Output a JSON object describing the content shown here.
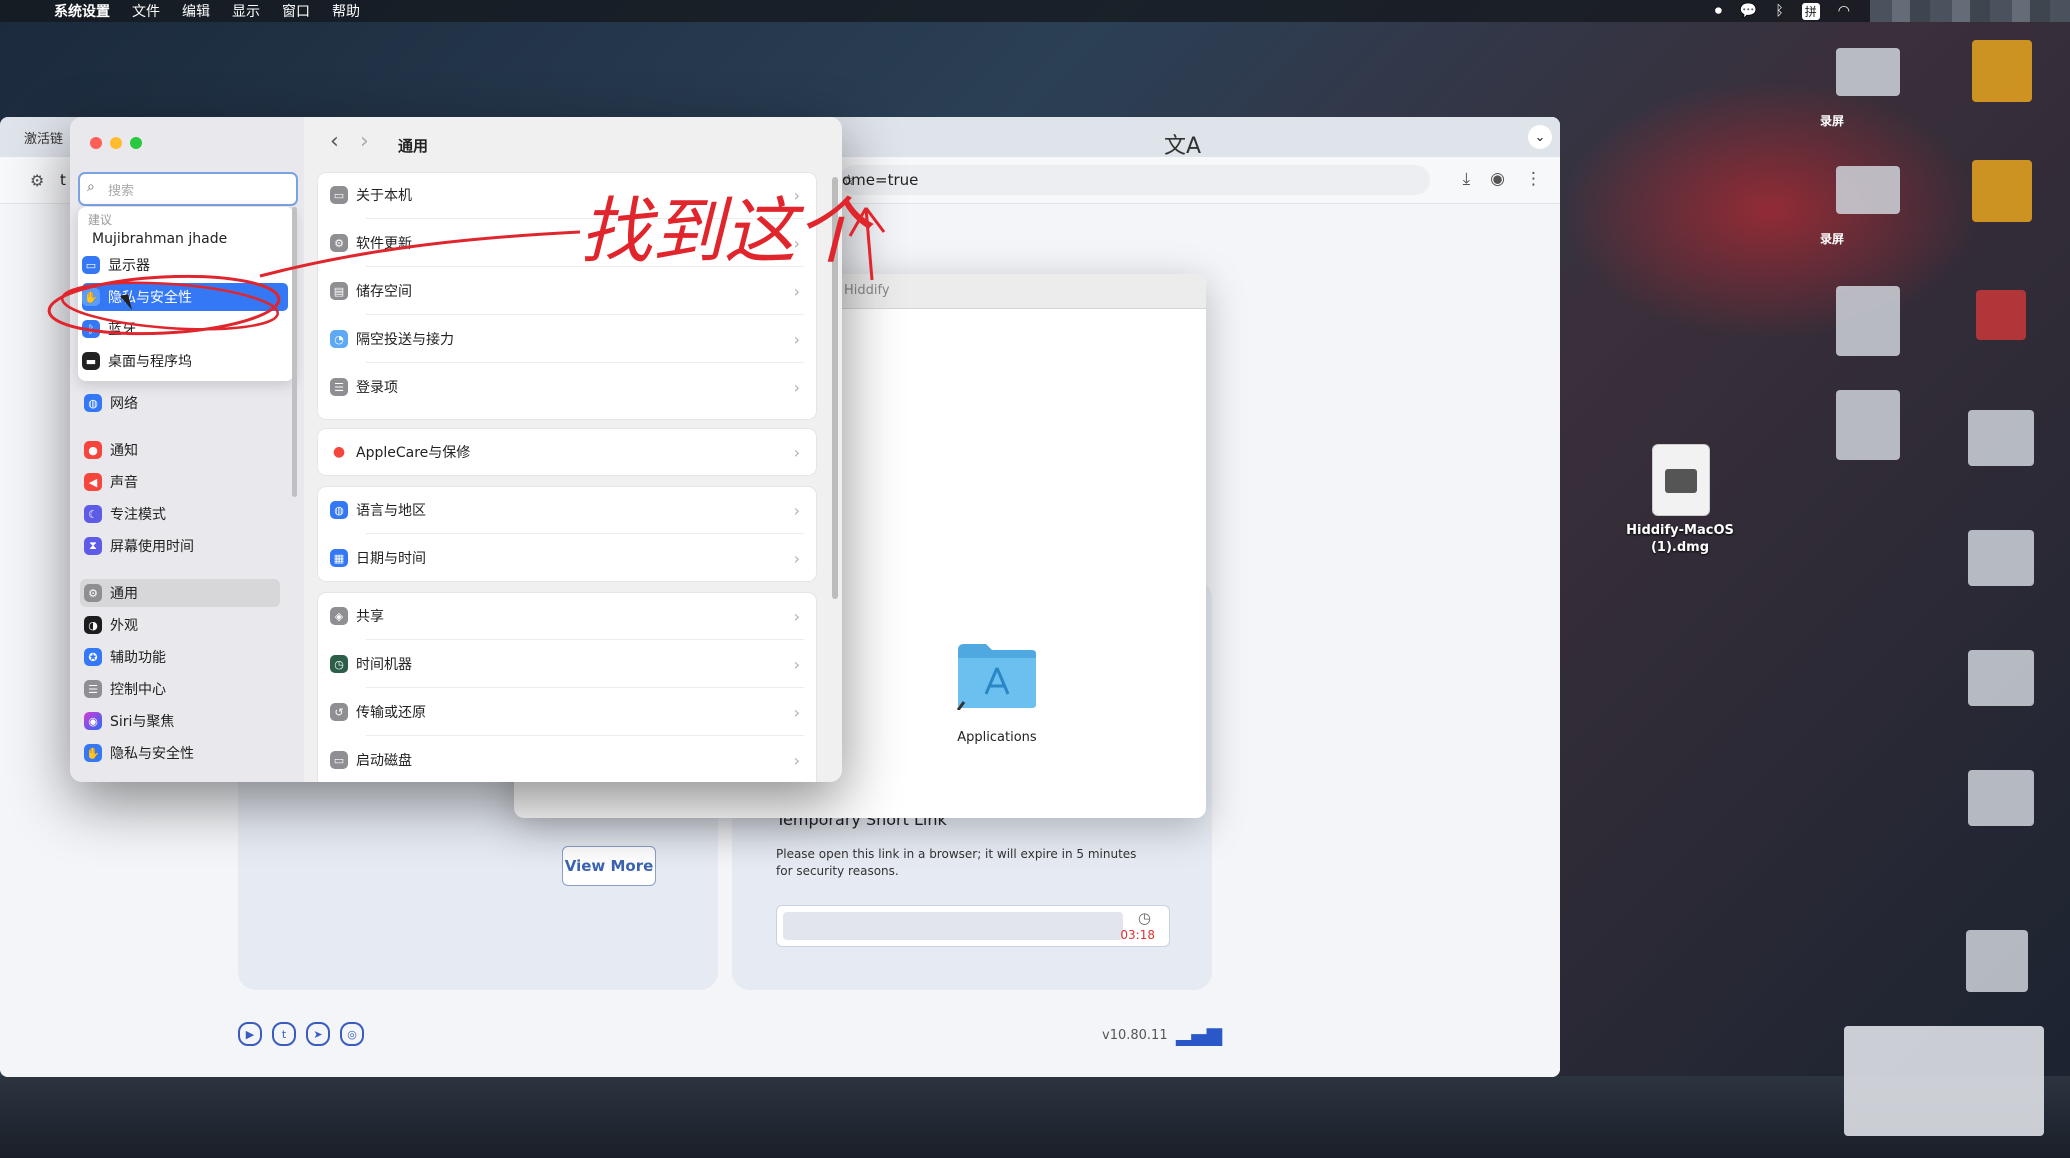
{
  "menubar": {
    "items": [
      "系统设置",
      "文件",
      "编辑",
      "显示",
      "窗口",
      "帮助"
    ],
    "status_icons": [
      "record-icon",
      "wechat-icon",
      "bluetooth-icon",
      "input-method-icon",
      "wifi-icon"
    ],
    "input_method_label": "拼"
  },
  "browser": {
    "tab_text": "激活链",
    "address_left_text": "t",
    "url_fragment": "ome=true",
    "page": {
      "dmg_window_title": "Hiddify",
      "apps_label": "Applications",
      "view_more_label": "View More",
      "temp_link_title": "Temporary Short Link",
      "temp_link_desc": "Please open this link in a browser; it will expire in 5 minutes for security reasons.",
      "countdown": "03:18",
      "version": "v10.80.11"
    }
  },
  "settings": {
    "search_placeholder": "搜索",
    "suggestions_header": "建议",
    "user_name": "Mujibrahman jhade",
    "suggestions": [
      "显示器",
      "隐私与安全性",
      "蓝牙",
      "桌面与程序坞"
    ],
    "sidebar_items": [
      "网络",
      "通知",
      "声音",
      "专注模式",
      "屏幕使用时间",
      "通用",
      "外观",
      "辅助功能",
      "控制中心",
      "Siri与聚焦",
      "隐私与安全性"
    ],
    "active_sidebar": "通用",
    "content_title": "通用",
    "groups": [
      [
        "关于本机",
        "软件更新",
        "储存空间",
        "隔空投送与接力",
        "登录项"
      ],
      [
        "AppleCare与保修"
      ],
      [
        "语言与地区",
        "日期与时间"
      ],
      [
        "共享",
        "时间机器",
        "传输或还原",
        "启动磁盘"
      ]
    ]
  },
  "desktop": {
    "dmg_file_label": "Hiddify-MacOS (1).dmg",
    "screenshot_labels": [
      "录屏",
      "录屏"
    ]
  },
  "annotation": {
    "handwritten_text": "找到这个"
  },
  "colors": {
    "accent_blue": "#3478f6",
    "annotation_red": "#e0262c"
  }
}
